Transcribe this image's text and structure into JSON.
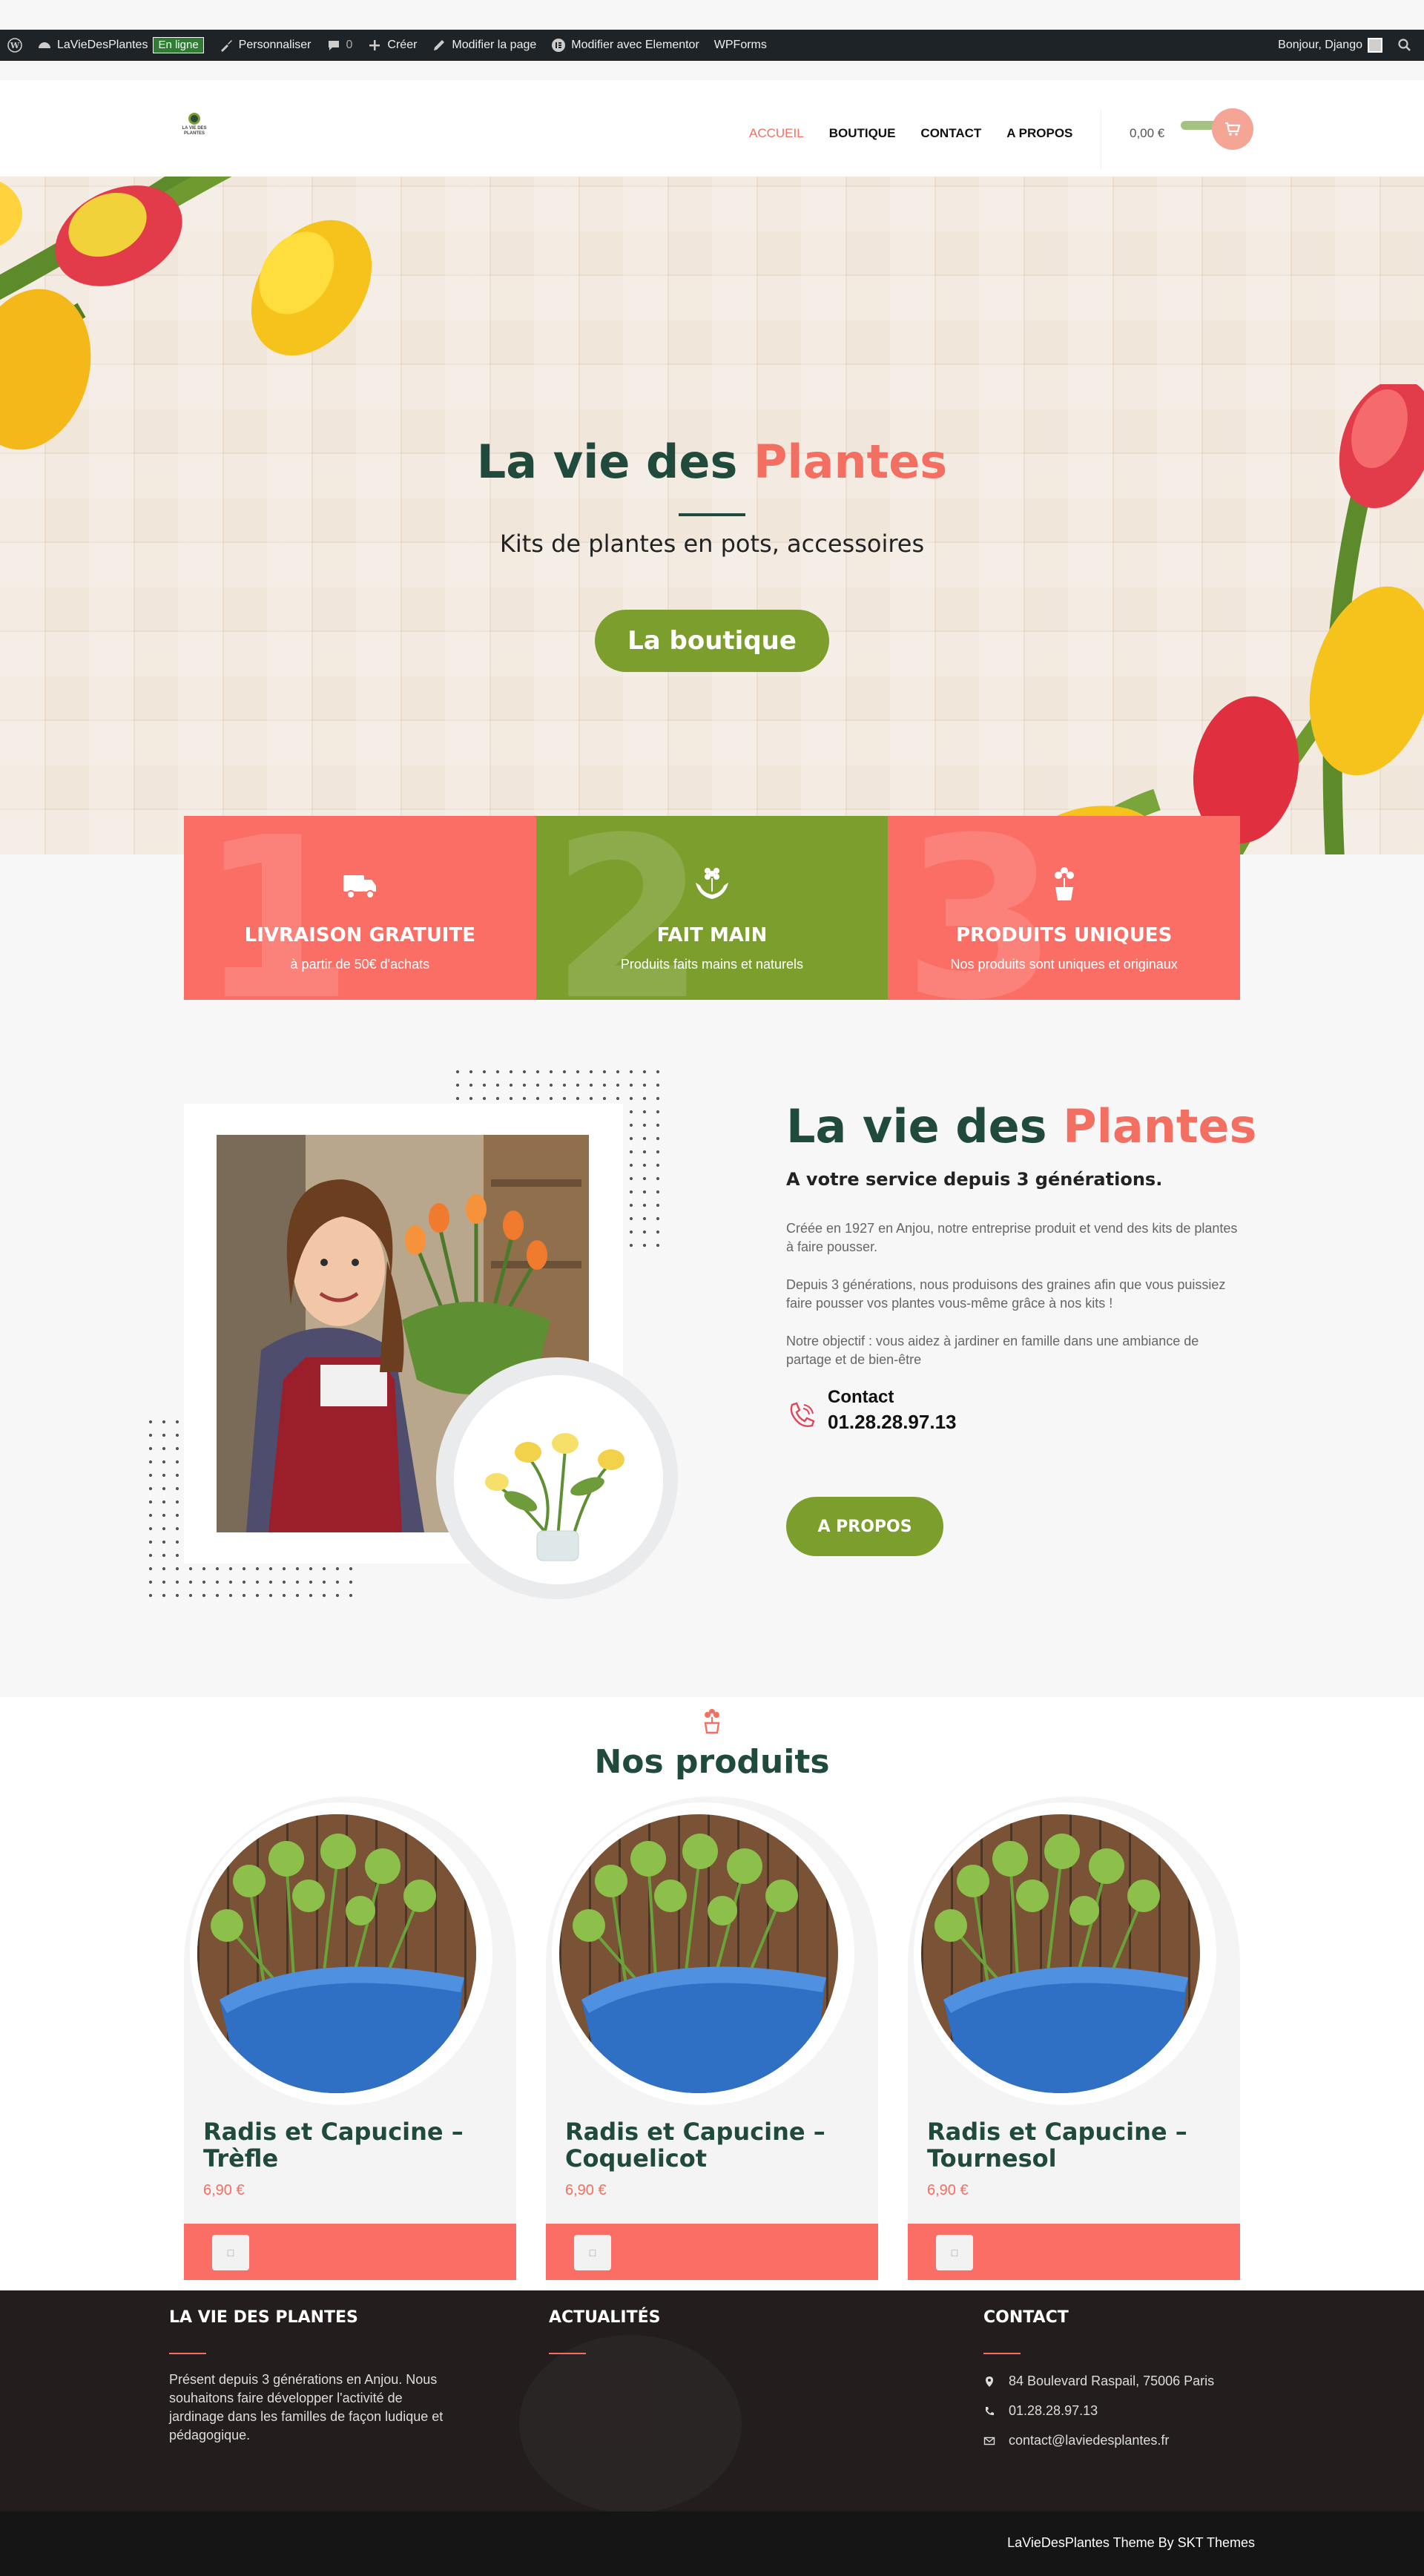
{
  "adminbar": {
    "site_name": "LaVieDesPlantes",
    "status_badge": "En ligne",
    "customize": "Personnaliser",
    "comments_count": "0",
    "create": "Créer",
    "edit_page": "Modifier la page",
    "edit_elementor": "Modifier avec Elementor",
    "wpforms": "WPForms",
    "greeting": "Bonjour, Django"
  },
  "header": {
    "logo_text": "LA VIE DES PLANTES",
    "nav": [
      "ACCUEIL",
      "BOUTIQUE",
      "CONTACT",
      "A PROPOS"
    ],
    "active_nav": "ACCUEIL",
    "cart_total": "0,00 €"
  },
  "hero": {
    "title_main": "La vie des",
    "title_accent": "Plantes",
    "subtitle": "Kits de plantes en pots, accessoires",
    "button": "La boutique"
  },
  "features": [
    {
      "num": "1",
      "icon": "truck-icon",
      "title": "LIVRAISON GRATUITE",
      "subtitle": "à partir de 50€ d'achats"
    },
    {
      "num": "2",
      "icon": "hands-flower-icon",
      "title": "FAIT MAIN",
      "subtitle": "Produits faits mains et naturels"
    },
    {
      "num": "3",
      "icon": "flower-pot-icon",
      "title": "PRODUITS UNIQUES",
      "subtitle": "Nos produits sont uniques et originaux"
    }
  ],
  "about": {
    "title_main": "La vie des",
    "title_accent": "Plantes",
    "subtitle": "A votre service depuis 3 générations.",
    "paragraphs": [
      "Créée en 1927 en Anjou, notre entreprise produit et vend des kits de plantes à faire pousser.",
      "Depuis 3 générations, nous produisons des graines afin que vous puissiez faire pousser vos plantes vous-même grâce à nos kits !",
      "Notre objectif : vous aidez à jardiner en famille dans une ambiance de partage et de bien-être"
    ],
    "contact_label": "Contact",
    "contact_phone": "01.28.28.97.13",
    "button": "A PROPOS"
  },
  "products": {
    "heading": "Nos produits",
    "items": [
      {
        "name": "Radis et Capucine – Trèfle",
        "price": "6,90 €"
      },
      {
        "name": "Radis et Capucine – Coquelicot",
        "price": "6,90 €"
      },
      {
        "name": "Radis et Capucine – Tournesol",
        "price": "6,90 €"
      }
    ]
  },
  "footer": {
    "col1_title": "LA VIE DES PLANTES",
    "col1_text": "Présent depuis 3 générations en Anjou. Nous souhaitons faire développer l'activité de jardinage dans les familles de façon ludique et pédagogique.",
    "col2_title": "ACTUALITÉS",
    "col3_title": "CONTACT",
    "address": "84 Boulevard Raspail, 75006 Paris",
    "phone": "01.28.28.97.13",
    "email": "contact@laviedesplantes.fr",
    "copyright": "LaVieDesPlantes Theme By SKT Themes"
  },
  "colors": {
    "coral": "#fa6e65",
    "green": "#7b9e2d",
    "dark_green": "#1f4a3c",
    "footer_bg": "#231e1d"
  }
}
